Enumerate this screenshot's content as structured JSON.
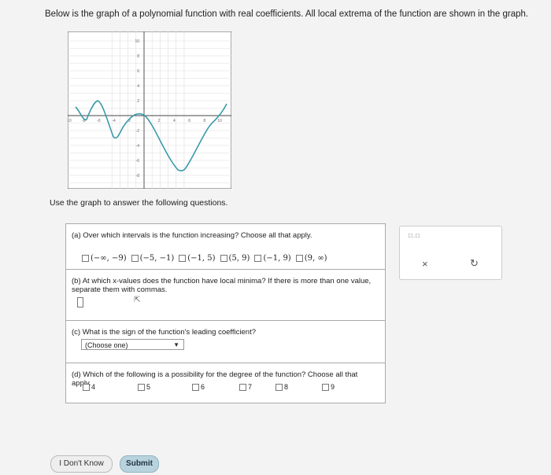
{
  "intro": "Below is the graph of a polynomial function with real coefficients. All local extrema of the function are shown in the graph.",
  "graph": {
    "y_ticks": [
      "10",
      "8",
      "6",
      "4",
      "2",
      "-2",
      "-4",
      "-6",
      "-8",
      "-10"
    ],
    "x_ticks": [
      "-10",
      "-8",
      "-6",
      "-4",
      "-2",
      "2",
      "4",
      "6",
      "8",
      "10"
    ],
    "curve_color": "#3a9bab"
  },
  "instruction": "Use the graph to answer the following questions.",
  "qa": {
    "text": "(a) Over which intervals is the function increasing? Choose all that apply.",
    "options": [
      "(−∞, −9)",
      "(−5, −1)",
      "(−1, 5)",
      "(5, 9)",
      "(−1, 9)",
      "(9, ∞)"
    ]
  },
  "qb": {
    "text": "(b) At which x-values does the function have local minima? If there is more than one value, separate them with commas."
  },
  "qc": {
    "text": "(c) What is the sign of the function's leading coefficient?",
    "select": "(Choose one)"
  },
  "qd": {
    "text": "(d) Which of the following is a possibility for the degree of the function? Choose all that apply.",
    "options": [
      "4",
      "5",
      "6",
      "7",
      "8",
      "9"
    ]
  },
  "side": {
    "icons": "□.□",
    "close": "×",
    "redo": "↻"
  },
  "buttons": {
    "dont_know": "I Don't Know",
    "submit": "Submit"
  }
}
